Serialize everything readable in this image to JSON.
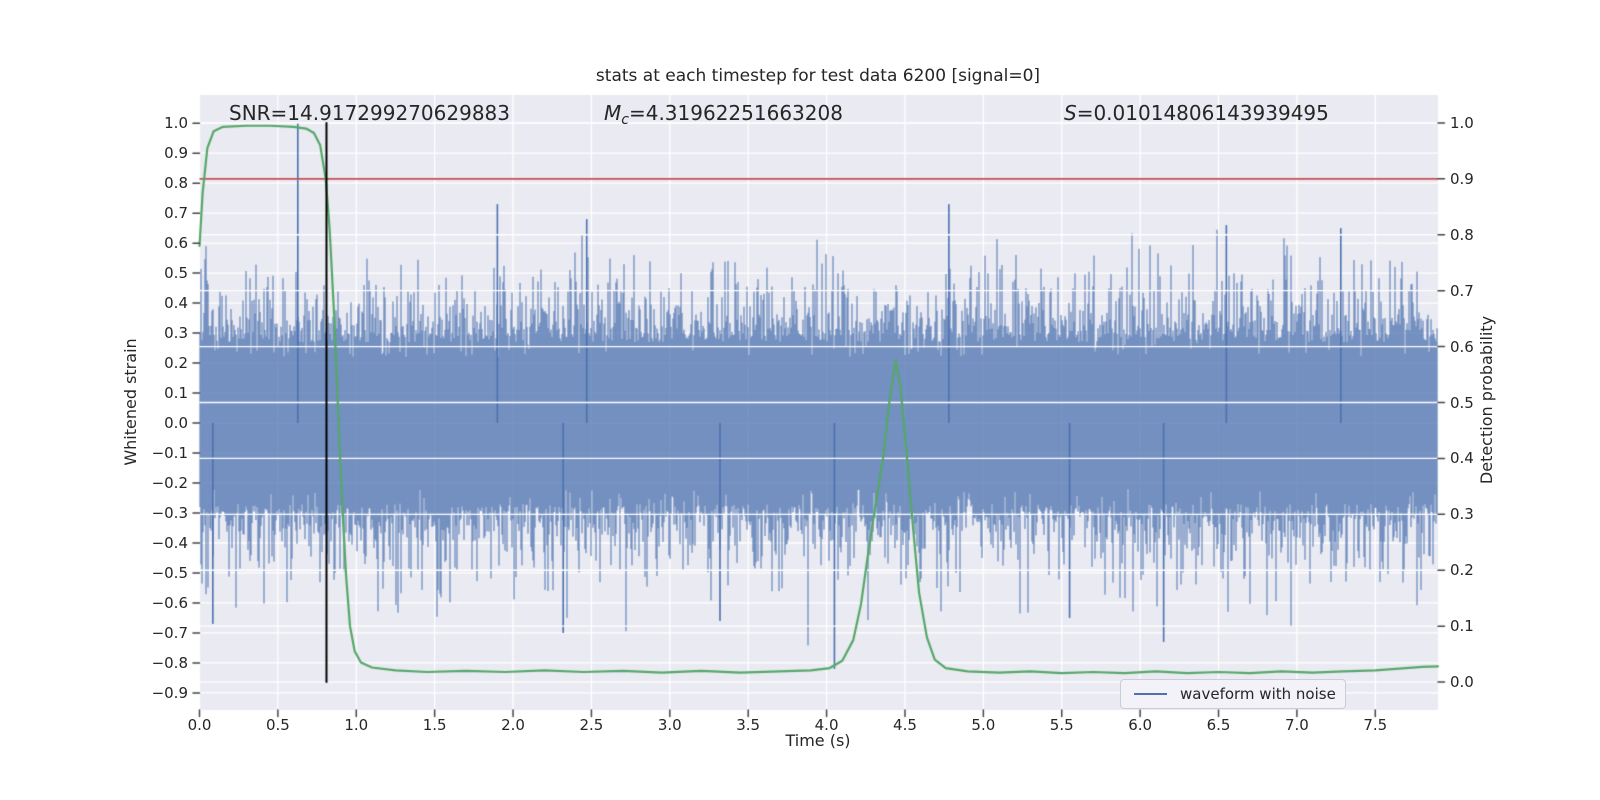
{
  "title": "stats at each timestep for test data 6200 [signal=0]",
  "stats": {
    "snr": "SNR=14.917299270629883",
    "mc_base": "M",
    "mc_sub": "c",
    "mc_rest": "=4.31962251663208",
    "s_base": "S",
    "s_rest": "=0.01014806143939495"
  },
  "axes": {
    "left_label": "Whitened strain",
    "right_label": "Detection probability",
    "x_label": "Time (s)"
  },
  "legend": {
    "label": "waveform with noise"
  },
  "colors": {
    "waveform": "#4c72b0",
    "probability": "#55a868",
    "threshold": "#c44e52",
    "marker": "#000000",
    "plot_background": "#eaeaf2",
    "grid": "#ffffff",
    "tick": "#444444",
    "text": "#262626"
  },
  "chart_data": {
    "type": "line",
    "title": "stats at each timestep for test data 6200 [signal=0]",
    "xlabel": "Time (s)",
    "ylabel_left": "Whitened strain",
    "ylabel_right": "Detection probability",
    "xlim": [
      0.0,
      7.9
    ],
    "ylim_left": [
      -0.957,
      1.094
    ],
    "ylim_right": [
      -0.05,
      1.05
    ],
    "grid": true,
    "legend_position": "lower right",
    "annotations": {
      "SNR": 14.917299270629883,
      "Mc": 4.31962251663208,
      "S": 0.01014806143939495
    },
    "threshold_line": {
      "axis": "right",
      "value": 0.9,
      "color": "#c44e52"
    },
    "event_marker": {
      "time": 0.81,
      "color": "#000000",
      "span_right_axis": [
        0.0,
        1.0
      ]
    },
    "xticks": [
      {
        "v": 0.0,
        "label": "0.0"
      },
      {
        "v": 0.5,
        "label": "0.5"
      },
      {
        "v": 1.0,
        "label": "1.0"
      },
      {
        "v": 1.5,
        "label": "1.5"
      },
      {
        "v": 2.0,
        "label": "2.0"
      },
      {
        "v": 2.5,
        "label": "2.5"
      },
      {
        "v": 3.0,
        "label": "3.0"
      },
      {
        "v": 3.5,
        "label": "3.5"
      },
      {
        "v": 4.0,
        "label": "4.0"
      },
      {
        "v": 4.5,
        "label": "4.5"
      },
      {
        "v": 5.0,
        "label": "5.0"
      },
      {
        "v": 5.5,
        "label": "5.5"
      },
      {
        "v": 6.0,
        "label": "6.0"
      },
      {
        "v": 6.5,
        "label": "6.5"
      },
      {
        "v": 7.0,
        "label": "7.0"
      },
      {
        "v": 7.5,
        "label": "7.5"
      }
    ],
    "yticks_left": [
      {
        "v": 1.0,
        "label": "1.0"
      },
      {
        "v": 0.9,
        "label": "0.9"
      },
      {
        "v": 0.8,
        "label": "0.8"
      },
      {
        "v": 0.7,
        "label": "0.7"
      },
      {
        "v": 0.6,
        "label": "0.6"
      },
      {
        "v": 0.5,
        "label": "0.5"
      },
      {
        "v": 0.4,
        "label": "0.4"
      },
      {
        "v": 0.3,
        "label": "0.3"
      },
      {
        "v": 0.2,
        "label": "0.2"
      },
      {
        "v": 0.1,
        "label": "0.1"
      },
      {
        "v": 0.0,
        "label": "0.0"
      },
      {
        "v": -0.1,
        "label": "−0.1"
      },
      {
        "v": -0.2,
        "label": "−0.2"
      },
      {
        "v": -0.3,
        "label": "−0.3"
      },
      {
        "v": -0.4,
        "label": "−0.4"
      },
      {
        "v": -0.5,
        "label": "−0.5"
      },
      {
        "v": -0.6,
        "label": "−0.6"
      },
      {
        "v": -0.7,
        "label": "−0.7"
      },
      {
        "v": -0.8,
        "label": "−0.8"
      },
      {
        "v": -0.9,
        "label": "−0.9"
      }
    ],
    "yticks_right": [
      {
        "v": 1.0,
        "label": "1.0"
      },
      {
        "v": 0.9,
        "label": "0.9"
      },
      {
        "v": 0.8,
        "label": "0.8"
      },
      {
        "v": 0.7,
        "label": "0.7"
      },
      {
        "v": 0.6,
        "label": "0.6"
      },
      {
        "v": 0.5,
        "label": "0.5"
      },
      {
        "v": 0.4,
        "label": "0.4"
      },
      {
        "v": 0.3,
        "label": "0.3"
      },
      {
        "v": 0.2,
        "label": "0.2"
      },
      {
        "v": 0.1,
        "label": "0.1"
      },
      {
        "v": 0.0,
        "label": "0.0"
      }
    ],
    "series": [
      {
        "name": "waveform with noise",
        "type": "noise_envelope",
        "axis": "left",
        "color": "#4c72b0",
        "description": "whitened strain noise: solid band about ±0.3 with dense spikes to ±0.55, occasional to ±0.75",
        "noise": {
          "seed": 6200,
          "base": 0.27,
          "base_jitter": 0.05,
          "notch_prob": 0.06,
          "spike_prob": 0.5,
          "spike_scale_top": 0.11,
          "spike_scale_bottom": 0.12,
          "max_extent": 0.76
        },
        "notable_points": [
          {
            "t": 0.085,
            "v": -0.67
          },
          {
            "t": 0.627,
            "v": 1.0
          },
          {
            "t": 1.9,
            "v": 0.73
          },
          {
            "t": 2.32,
            "v": -0.7
          },
          {
            "t": 2.47,
            "v": 0.68
          },
          {
            "t": 3.32,
            "v": -0.66
          },
          {
            "t": 4.05,
            "v": -0.82
          },
          {
            "t": 4.78,
            "v": 0.73
          },
          {
            "t": 5.55,
            "v": -0.65
          },
          {
            "t": 6.15,
            "v": -0.73
          },
          {
            "t": 6.55,
            "v": 0.66
          },
          {
            "t": 7.28,
            "v": 0.65
          }
        ]
      },
      {
        "name": "detection probability",
        "type": "line",
        "axis": "right",
        "color": "#55a868",
        "points": [
          [
            0.0,
            0.78
          ],
          [
            0.02,
            0.875
          ],
          [
            0.05,
            0.955
          ],
          [
            0.09,
            0.985
          ],
          [
            0.15,
            0.993
          ],
          [
            0.3,
            0.995
          ],
          [
            0.45,
            0.995
          ],
          [
            0.6,
            0.993
          ],
          [
            0.68,
            0.99
          ],
          [
            0.73,
            0.982
          ],
          [
            0.77,
            0.96
          ],
          [
            0.805,
            0.9
          ],
          [
            0.83,
            0.81
          ],
          [
            0.86,
            0.65
          ],
          [
            0.885,
            0.48
          ],
          [
            0.91,
            0.32
          ],
          [
            0.935,
            0.19
          ],
          [
            0.96,
            0.1
          ],
          [
            0.99,
            0.055
          ],
          [
            1.03,
            0.035
          ],
          [
            1.1,
            0.026
          ],
          [
            1.25,
            0.021
          ],
          [
            1.45,
            0.018
          ],
          [
            1.7,
            0.02
          ],
          [
            1.95,
            0.018
          ],
          [
            2.2,
            0.021
          ],
          [
            2.45,
            0.018
          ],
          [
            2.7,
            0.02
          ],
          [
            2.95,
            0.017
          ],
          [
            3.2,
            0.02
          ],
          [
            3.45,
            0.017
          ],
          [
            3.7,
            0.019
          ],
          [
            3.9,
            0.021
          ],
          [
            4.02,
            0.025
          ],
          [
            4.1,
            0.038
          ],
          [
            4.17,
            0.075
          ],
          [
            4.22,
            0.14
          ],
          [
            4.27,
            0.24
          ],
          [
            4.32,
            0.33
          ],
          [
            4.36,
            0.4
          ],
          [
            4.4,
            0.5
          ],
          [
            4.44,
            0.575
          ],
          [
            4.47,
            0.53
          ],
          [
            4.51,
            0.41
          ],
          [
            4.55,
            0.28
          ],
          [
            4.59,
            0.16
          ],
          [
            4.64,
            0.08
          ],
          [
            4.69,
            0.04
          ],
          [
            4.76,
            0.025
          ],
          [
            4.9,
            0.019
          ],
          [
            5.1,
            0.017
          ],
          [
            5.3,
            0.019
          ],
          [
            5.5,
            0.016
          ],
          [
            5.7,
            0.018
          ],
          [
            5.9,
            0.016
          ],
          [
            6.1,
            0.019
          ],
          [
            6.3,
            0.016
          ],
          [
            6.5,
            0.018
          ],
          [
            6.7,
            0.016
          ],
          [
            6.9,
            0.019
          ],
          [
            7.1,
            0.017
          ],
          [
            7.3,
            0.019
          ],
          [
            7.5,
            0.021
          ],
          [
            7.65,
            0.024
          ],
          [
            7.8,
            0.027
          ],
          [
            7.9,
            0.028
          ]
        ]
      }
    ]
  }
}
